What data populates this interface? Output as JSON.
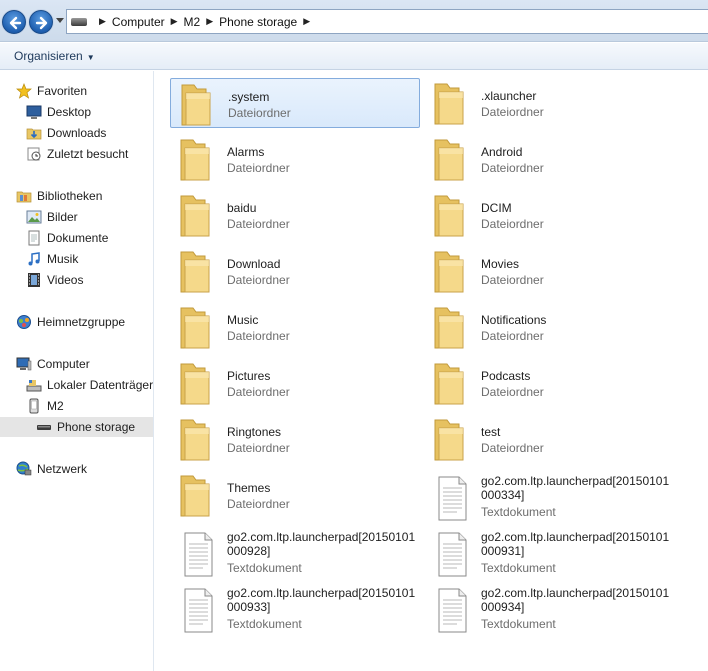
{
  "address": {
    "crumbs": [
      "Computer",
      "M2",
      "Phone storage"
    ]
  },
  "toolbar": {
    "organize_label": "Organisieren"
  },
  "sidebar": {
    "items": [
      {
        "label": "Favoriten",
        "icon": "star-icon"
      },
      {
        "label": "Desktop",
        "icon": "desktop-icon"
      },
      {
        "label": "Downloads",
        "icon": "downloads-folder-icon"
      },
      {
        "label": "Zuletzt besucht",
        "icon": "recent-places-icon"
      },
      {
        "label": "Bibliotheken",
        "icon": "libraries-icon"
      },
      {
        "label": "Bilder",
        "icon": "pictures-icon"
      },
      {
        "label": "Dokumente",
        "icon": "documents-icon"
      },
      {
        "label": "Musik",
        "icon": "music-icon"
      },
      {
        "label": "Videos",
        "icon": "videos-icon"
      },
      {
        "label": "Heimnetzgruppe",
        "icon": "homegroup-icon"
      },
      {
        "label": "Computer",
        "icon": "computer-icon"
      },
      {
        "label": "Lokaler Datenträger",
        "icon": "local-disk-icon"
      },
      {
        "label": "M2",
        "icon": "phone-device-icon"
      },
      {
        "label": "Phone storage",
        "icon": "storage-drive-icon"
      },
      {
        "label": "Netzwerk",
        "icon": "network-icon"
      }
    ]
  },
  "files": [
    {
      "name": ".system",
      "type": "Dateiordner",
      "kind": "folder"
    },
    {
      "name": ".xlauncher",
      "type": "Dateiordner",
      "kind": "folder"
    },
    {
      "name": "Alarms",
      "type": "Dateiordner",
      "kind": "folder"
    },
    {
      "name": "Android",
      "type": "Dateiordner",
      "kind": "folder"
    },
    {
      "name": "baidu",
      "type": "Dateiordner",
      "kind": "folder"
    },
    {
      "name": "DCIM",
      "type": "Dateiordner",
      "kind": "folder"
    },
    {
      "name": "Download",
      "type": "Dateiordner",
      "kind": "folder"
    },
    {
      "name": "Movies",
      "type": "Dateiordner",
      "kind": "folder"
    },
    {
      "name": "Music",
      "type": "Dateiordner",
      "kind": "folder"
    },
    {
      "name": "Notifications",
      "type": "Dateiordner",
      "kind": "folder"
    },
    {
      "name": "Pictures",
      "type": "Dateiordner",
      "kind": "folder"
    },
    {
      "name": "Podcasts",
      "type": "Dateiordner",
      "kind": "folder"
    },
    {
      "name": "Ringtones",
      "type": "Dateiordner",
      "kind": "folder"
    },
    {
      "name": "test",
      "type": "Dateiordner",
      "kind": "folder"
    },
    {
      "name": "Themes",
      "type": "Dateiordner",
      "kind": "folder"
    },
    {
      "name": "go2.com.ltp.launcherpad[20150101000334]",
      "type": "Textdokument",
      "kind": "document"
    },
    {
      "name": "go2.com.ltp.launcherpad[20150101000928]",
      "type": "Textdokument",
      "kind": "document"
    },
    {
      "name": "go2.com.ltp.launcherpad[20150101000931]",
      "type": "Textdokument",
      "kind": "document"
    },
    {
      "name": "go2.com.ltp.launcherpad[20150101000933]",
      "type": "Textdokument",
      "kind": "document"
    },
    {
      "name": "go2.com.ltp.launcherpad[20150101000934]",
      "type": "Textdokument",
      "kind": "document"
    }
  ],
  "selected_file": ".system",
  "selected_nav": "Phone storage",
  "colors": {
    "selection_border": "#84acdd",
    "selection_fill": "#d9e9fb",
    "secondary_text": "#6d6d6d",
    "toolbar_text": "#1e395b"
  }
}
